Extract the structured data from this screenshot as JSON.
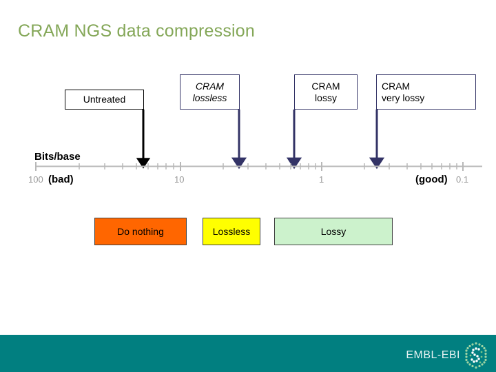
{
  "slide": {
    "title": "CRAM NGS data compression",
    "title_color": "#84a758",
    "background": "#ffffff"
  },
  "top_boxes": [
    {
      "label": "Untreated",
      "style": "plain-black-border",
      "arrow_color": "#000000"
    },
    {
      "label": "CRAM\nlossless",
      "style": "italic-navy-border",
      "arrow_color": "#333366"
    },
    {
      "label": "CRAM\nlossy",
      "style": "navy-border",
      "arrow_color": "#333366"
    },
    {
      "label": "CRAM\nvery lossy",
      "style": "navy-border-left",
      "arrow_color": "#333366"
    }
  ],
  "top_box_labels": {
    "untreated": "Untreated",
    "cram_lossless_line1": "CRAM",
    "cram_lossless_line2": "lossless",
    "cram_lossy_line1": "CRAM",
    "cram_lossy_line2": "lossy",
    "cram_very_lossy_line1": "CRAM",
    "cram_very_lossy_line2": "very lossy"
  },
  "axis": {
    "name": "Bits/base",
    "tick_labels": [
      "100",
      "10",
      "1",
      "0.1"
    ],
    "tick_color": "#999999",
    "bad_label": "(bad)",
    "good_label": "(good)",
    "scale": "logarithmic"
  },
  "category_boxes": [
    {
      "label": "Do nothing",
      "color": "#ff6600"
    },
    {
      "label": "Lossless",
      "color": "#ffff00"
    },
    {
      "label": "Lossy",
      "color": "#ccf2cc"
    }
  ],
  "category_labels": {
    "do_nothing": "Do nothing",
    "lossless": "Lossless",
    "lossy": "Lossy"
  },
  "footer": {
    "background": "#017f80",
    "logo_text": "EMBL-EBI",
    "logo_icon": "embl-ebi-hexagon-logo"
  },
  "chart_data": {
    "type": "scatter",
    "title": "CRAM NGS data compression",
    "xlabel": "Bits/base",
    "ylabel": "",
    "xscale": "log",
    "xlim": [
      100,
      0.1
    ],
    "x_ticks": [
      100,
      10,
      1,
      0.1
    ],
    "x_tick_labels": [
      "100",
      "10",
      "1",
      "0.1"
    ],
    "grid": false,
    "legend": "none",
    "annotations": [
      "(bad)",
      "(good)"
    ],
    "categories": [
      "Untreated",
      "CRAM lossless",
      "CRAM lossy",
      "CRAM very lossy"
    ],
    "values": [
      25,
      3.2,
      1.05,
      0.36
    ],
    "series": [
      {
        "name": "Compression markers (bits/base)",
        "points": [
          {
            "label": "Untreated",
            "x": 25,
            "marker": "down-arrow",
            "color": "#000000"
          },
          {
            "label": "CRAM lossless",
            "x": 3.2,
            "marker": "down-arrow",
            "color": "#333366"
          },
          {
            "label": "CRAM lossy",
            "x": 1.05,
            "marker": "down-arrow",
            "color": "#333366"
          },
          {
            "label": "CRAM very lossy",
            "x": 0.36,
            "marker": "down-arrow",
            "color": "#333366"
          }
        ]
      }
    ],
    "bands": [
      {
        "label": "Do nothing",
        "color": "#ff6600",
        "x_start": 40,
        "x_end": 4.5
      },
      {
        "label": "Lossless",
        "color": "#ffff00",
        "x_start": 2.6,
        "x_end": 1.25
      },
      {
        "label": "Lossy",
        "color": "#ccf2cc",
        "x_start": 1.0,
        "x_end": 0.23
      }
    ]
  }
}
